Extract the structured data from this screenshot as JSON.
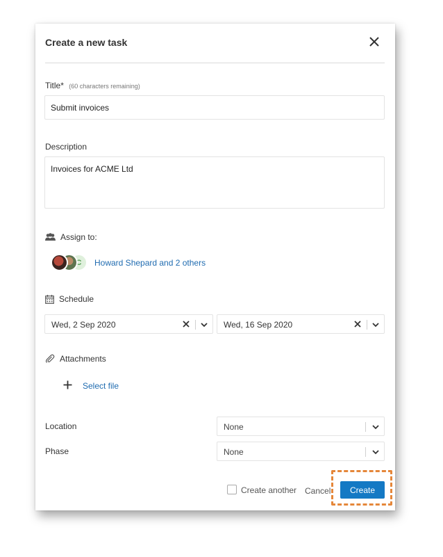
{
  "dialog": {
    "title": "Create a new task",
    "title_field": {
      "label": "Title*",
      "hint": "(60 characters remaining)",
      "value": "Submit invoices"
    },
    "description_field": {
      "label": "Description",
      "value": "Invoices for ACME Ltd"
    },
    "assign": {
      "label": "Assign to:",
      "assignees_text": "Howard Shepard and 2 others",
      "third_avatar_initial": "C"
    },
    "schedule": {
      "label": "Schedule",
      "start_date": "Wed, 2 Sep 2020",
      "end_date": "Wed, 16 Sep 2020"
    },
    "attachments": {
      "label": "Attachments",
      "select_file": "Select file"
    },
    "location": {
      "label": "Location",
      "value": "None"
    },
    "phase": {
      "label": "Phase",
      "value": "None"
    },
    "footer": {
      "create_another_label": "Create another",
      "create_another_checked": false,
      "cancel_label": "Cancel",
      "create_label": "Create"
    }
  },
  "colors": {
    "accent": "#1479c4",
    "link": "#1f6bb0",
    "highlight": "#e5873a"
  },
  "icons": [
    "close-icon",
    "people-icon",
    "calendar-icon",
    "paperclip-icon",
    "plus-icon",
    "clear-icon",
    "chevron-down-icon"
  ]
}
